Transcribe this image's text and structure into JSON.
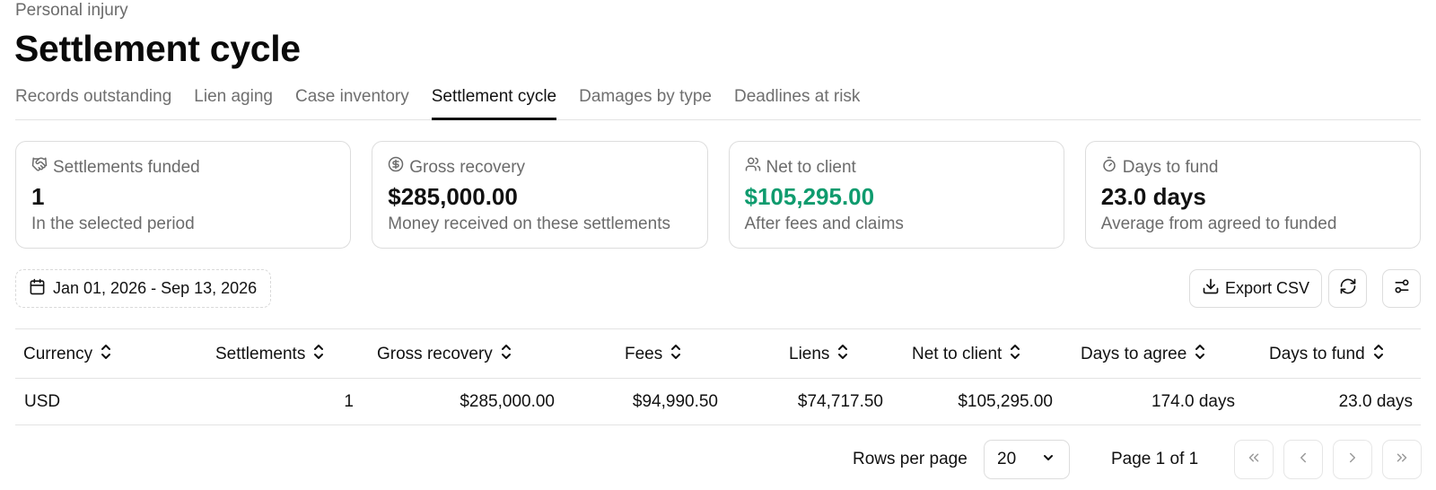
{
  "header": {
    "breadcrumb": "Personal injury",
    "title": "Settlement cycle"
  },
  "tabs": [
    {
      "label": "Records outstanding",
      "active": false
    },
    {
      "label": "Lien aging",
      "active": false
    },
    {
      "label": "Case inventory",
      "active": false
    },
    {
      "label": "Settlement cycle",
      "active": true
    },
    {
      "label": "Damages by type",
      "active": false
    },
    {
      "label": "Deadlines at risk",
      "active": false
    }
  ],
  "cards": [
    {
      "icon": "handshake-icon",
      "label": "Settlements funded",
      "value": "1",
      "sub": "In the selected period"
    },
    {
      "icon": "dollar-circle-icon",
      "label": "Gross recovery",
      "value": "$285,000.00",
      "sub": "Money received on these settlements"
    },
    {
      "icon": "users-icon",
      "label": "Net to client",
      "value": "$105,295.00",
      "sub": "After fees and claims",
      "value_color": "#0f9b6e"
    },
    {
      "icon": "timer-icon",
      "label": "Days to fund",
      "value": "23.0 days",
      "sub": "Average from agreed to funded"
    }
  ],
  "toolbar": {
    "date_range": "Jan 01, 2026 - Sep 13, 2026",
    "export_label": "Export CSV",
    "refresh_icon": "refresh-icon",
    "settings_icon": "sliders-icon"
  },
  "table": {
    "columns": [
      "Currency",
      "Settlements",
      "Gross recovery",
      "Fees",
      "Liens",
      "Net to client",
      "Days to agree",
      "Days to fund"
    ],
    "rows": [
      [
        "USD",
        "1",
        "$285,000.00",
        "$94,990.50",
        "$74,717.50",
        "$105,295.00",
        "174.0 days",
        "23.0 days"
      ]
    ]
  },
  "pagination": {
    "rows_per_page_label": "Rows per page",
    "rows_per_page_value": "20",
    "page_info": "Page 1 of 1"
  },
  "colors": {
    "accent_green": "#0f9b6e",
    "border": "#dddddd",
    "muted_text": "#6b6b6b"
  }
}
